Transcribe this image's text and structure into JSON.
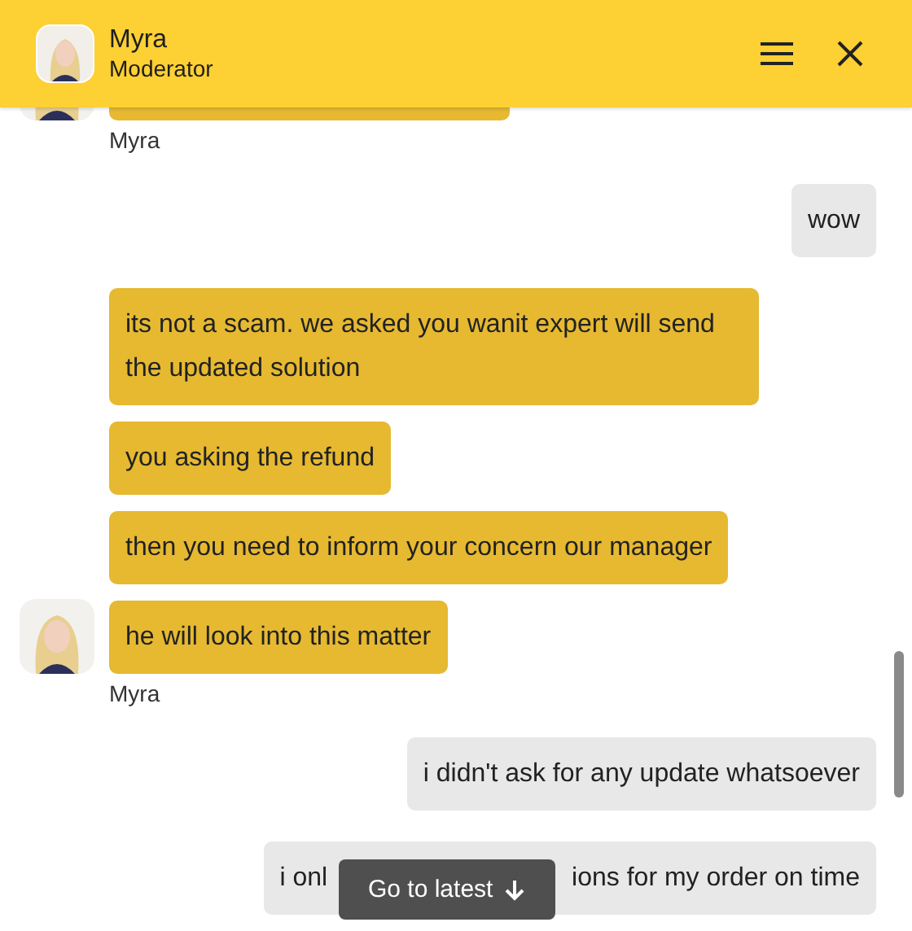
{
  "header": {
    "name": "Myra",
    "role": "Moderator"
  },
  "groups": [
    {
      "kind": "incoming",
      "sender": "Myra",
      "messages": [
        {
          "kind": "cut"
        }
      ]
    },
    {
      "kind": "outgoing",
      "messages": [
        {
          "kind": "text",
          "text": "wow"
        }
      ]
    },
    {
      "kind": "incoming",
      "sender": "Myra",
      "messages": [
        {
          "kind": "text",
          "text": "its not a scam. we asked you wanit expert will send the updated solution"
        },
        {
          "kind": "text",
          "text": "you asking the refund"
        },
        {
          "kind": "text",
          "text": "then you need to inform your concern our manager"
        },
        {
          "kind": "text",
          "text": "he will look into this matter"
        }
      ]
    },
    {
      "kind": "outgoing",
      "messages": [
        {
          "kind": "text",
          "text": "i didn't ask for any update whatsoever"
        },
        {
          "kind": "covered",
          "text_start": "i onl",
          "text_end": "ions for my order on time"
        }
      ]
    }
  ],
  "latest_button": {
    "label": "Go to latest"
  }
}
